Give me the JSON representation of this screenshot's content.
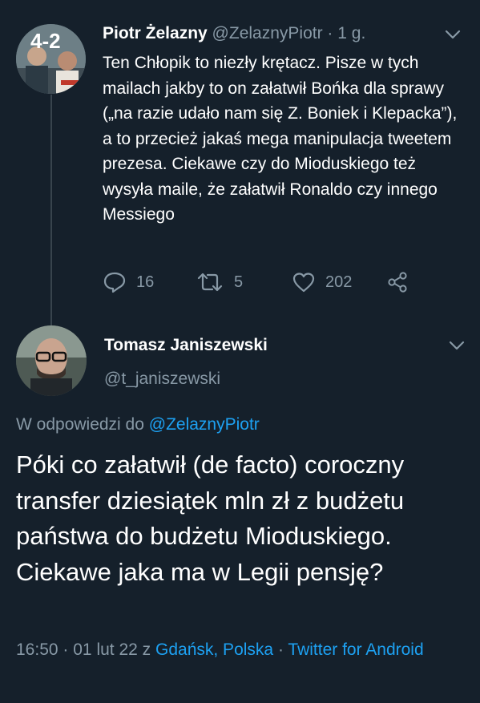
{
  "tweet1": {
    "author_name": "Piotr Żelazny",
    "handle": "@ZelaznyPiotr",
    "separator": "·",
    "time_ago": "1 g.",
    "avatar_overlay": "4-2",
    "text": "Ten Chłopik to niezły krętacz. Pisze w tych mailach jakby to on załatwił Bońka dla sprawy („na razie udało nam się Z. Boniek i Klepacka”), a to przecież jakaś mega manipulacja tweetem prezesa. Ciekawe czy do Mioduskiego też wysyła maile, że załatwił Ronaldo czy innego Messiego",
    "reply_count": "16",
    "retweet_count": "5",
    "like_count": "202",
    "icons": [
      "reply-icon",
      "retweet-icon",
      "like-icon",
      "share-icon",
      "chevron-down-icon"
    ]
  },
  "tweet2": {
    "author_name": "Tomasz Janiszewski",
    "handle": "@t_janiszewski",
    "reply_prefix": "W odpowiedzi do",
    "reply_to_handle": "@ZelaznyPiotr",
    "text": "Póki co załatwił (de facto) coroczny transfer dziesiątek mln zł z budżetu państwa do budżetu Mioduskiego. Ciekawe jaka ma w Legii pensję?",
    "time": "16:50",
    "separator1": "·",
    "date": "01 lut 22",
    "from_word": "z",
    "location": "Gdańsk, Polska",
    "separator2": "·",
    "source": "Twitter for Android"
  },
  "colors": {
    "background": "#15202b",
    "muted": "#8899a6",
    "link": "#1da1f2",
    "text": "#ffffff"
  }
}
